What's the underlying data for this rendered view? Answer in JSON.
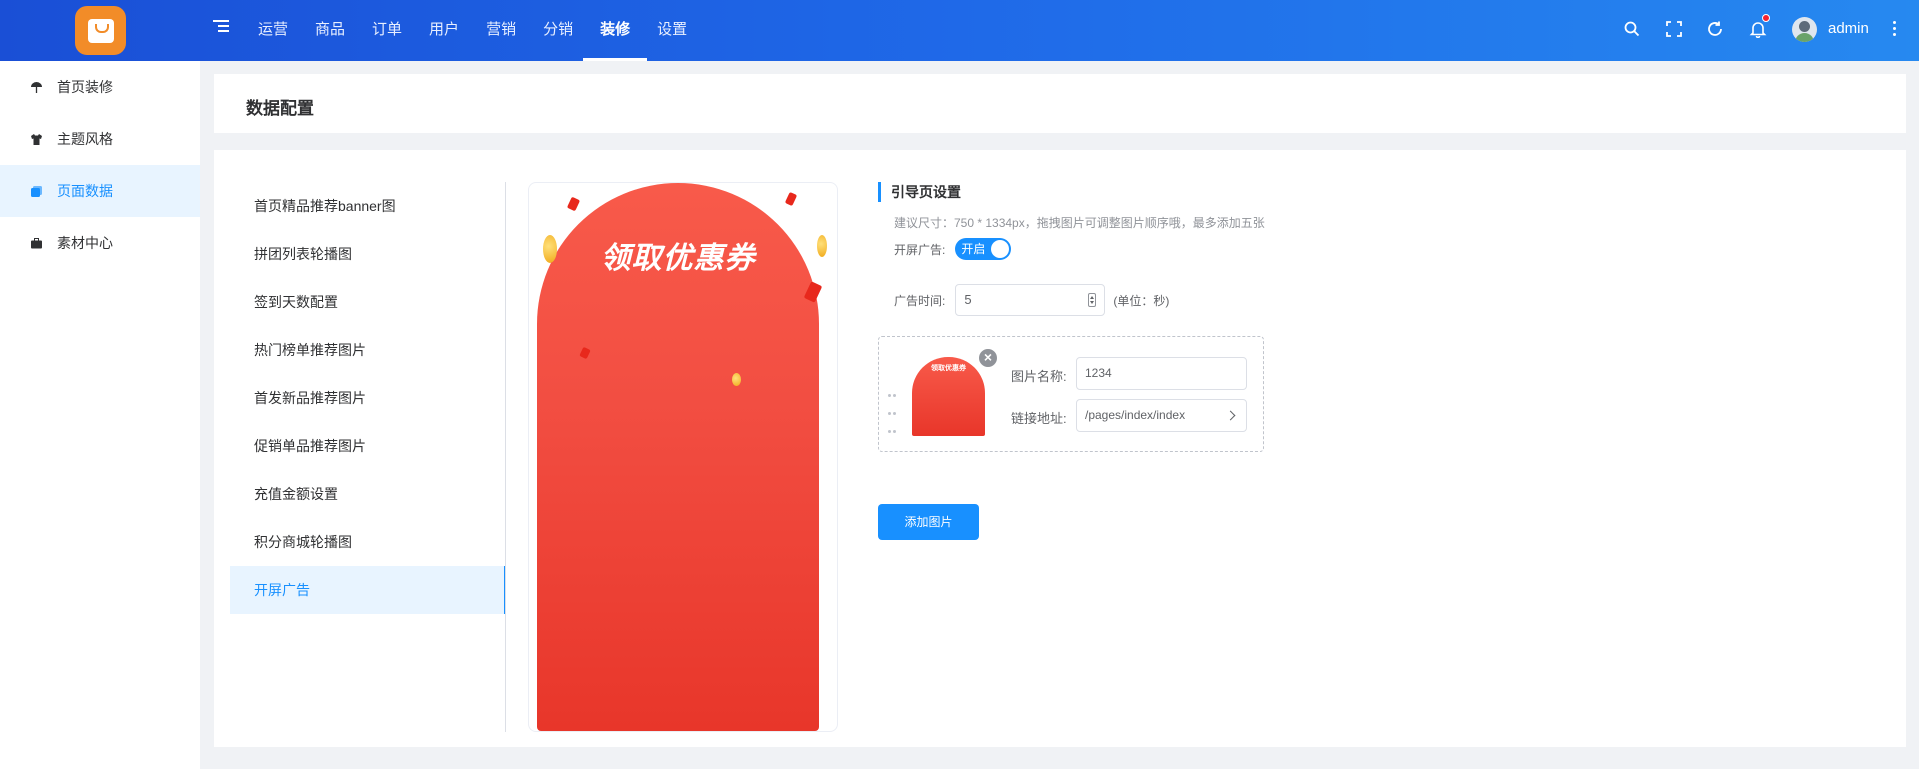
{
  "topbar": {
    "nav": [
      "运营",
      "商品",
      "订单",
      "用户",
      "营销",
      "分销",
      "装修",
      "设置"
    ],
    "active_nav": "装修",
    "username": "admin",
    "icons": [
      "search-icon",
      "fullscreen-icon",
      "refresh-icon",
      "bell-icon",
      "more-icon"
    ],
    "accent": "#1890ff"
  },
  "sidebar": {
    "items": [
      {
        "label": "首页装修",
        "icon": "umbrella-icon"
      },
      {
        "label": "主题风格",
        "icon": "shirt-icon"
      },
      {
        "label": "页面数据",
        "icon": "pages-icon"
      },
      {
        "label": "素材中心",
        "icon": "briefcase-icon"
      }
    ],
    "active": "页面数据"
  },
  "page": {
    "title": "数据配置"
  },
  "menu": {
    "items": [
      "首页精品推荐banner图",
      "拼团列表轮播图",
      "签到天数配置",
      "热门榜单推荐图片",
      "首发新品推荐图片",
      "促销单品推荐图片",
      "充值金额设置",
      "积分商城轮播图",
      "开屏广告"
    ],
    "active": "开屏广告"
  },
  "preview": {
    "banner_text": "领取优惠券"
  },
  "settings": {
    "section_title": "引导页设置",
    "hint": "建议尺寸：750 * 1334px，拖拽图片可调整图片顺序哦，最多添加五张",
    "ad_label": "开屏广告:",
    "ad_switch": "开启",
    "time_label": "广告时间:",
    "time_value": "5",
    "time_unit": "(单位：秒)",
    "image": {
      "thumb_text": "领取优惠券",
      "name_label": "图片名称:",
      "name_value": "1234",
      "link_label": "链接地址:",
      "link_value": "/pages/index/index"
    },
    "add_button": "添加图片"
  }
}
